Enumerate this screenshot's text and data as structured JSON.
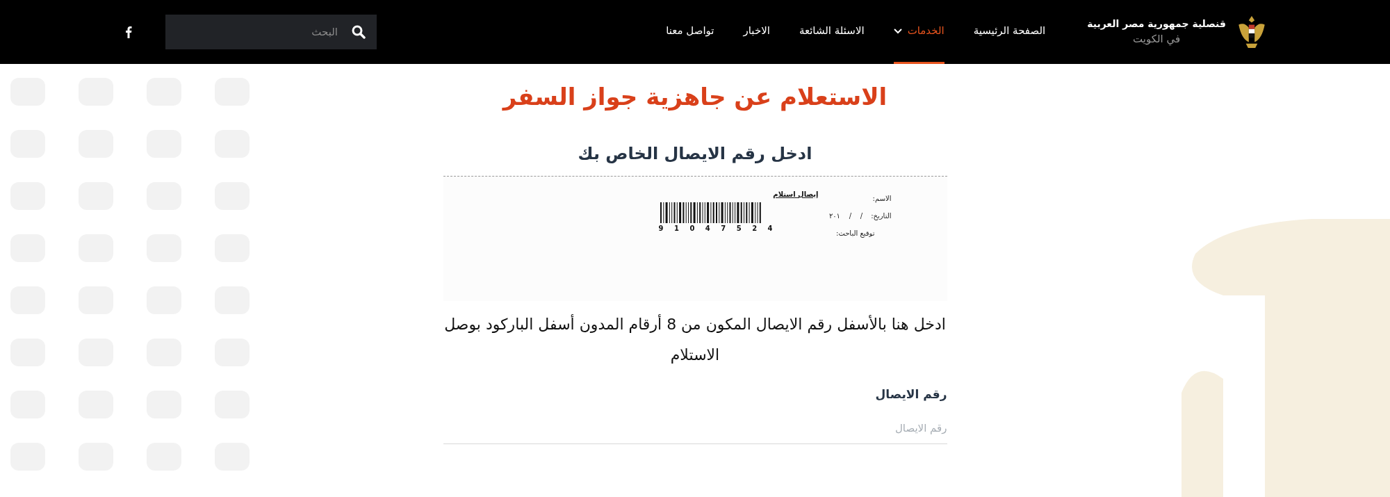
{
  "header": {
    "logo_title": "قنصلية جمهورية مصر العربية",
    "logo_subtitle": "في الكويت",
    "nav": [
      {
        "label": "الصفحة الرئيسية",
        "selected": false,
        "dropdown": false
      },
      {
        "label": "الخدمات",
        "selected": true,
        "dropdown": true
      },
      {
        "label": "الاسئلة الشائعة",
        "selected": false,
        "dropdown": false
      },
      {
        "label": "الاخبار",
        "selected": false,
        "dropdown": false
      },
      {
        "label": "تواصل معنا",
        "selected": false,
        "dropdown": false
      }
    ],
    "search": {
      "placeholder": "البحث"
    }
  },
  "page_title": "الاستعلام عن جاهزية جواز السفر",
  "subtitle": "ادخل رقم الايصال الخاص بك",
  "receipt": {
    "heading": "إيصال استلام",
    "barcode_number": "9 1 0 4 7 5 2 4",
    "name_label": "الاسم:",
    "date_label": "التاريخ:",
    "date_value": "/    /    ٢٠١",
    "signature_label": "توقيع الباحث:"
  },
  "instructions": "ادخل هنا بالأسفل رقم الايصال المكون من 8 أرقام المدون أسفل الباركود بوصل الاستلام",
  "field": {
    "label": "رقم الايصال",
    "placeholder": "رقم الايصال"
  }
}
